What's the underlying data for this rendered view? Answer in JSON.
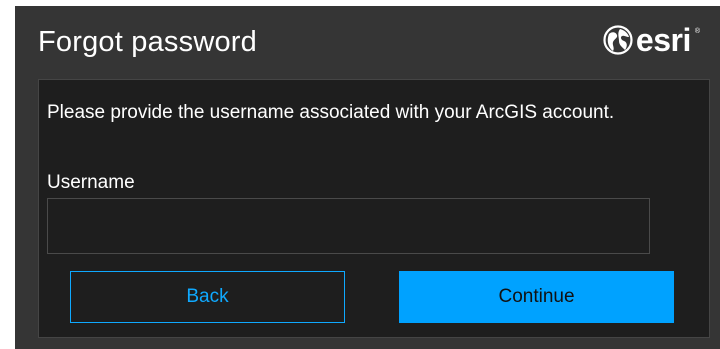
{
  "dialog": {
    "title": "Forgot password",
    "logo": {
      "text": "esri",
      "tm": "®",
      "icon": "globe-icon"
    },
    "message": "Please provide the username associated with your ArcGIS account.",
    "username": {
      "label": "Username",
      "value": "",
      "placeholder": ""
    },
    "buttons": {
      "back_label": "Back",
      "continue_label": "Continue"
    }
  },
  "colors": {
    "dialog_bg": "#353535",
    "panel_bg": "#1e1e1e",
    "accent": "#00a2ff",
    "text": "#ffffff"
  }
}
